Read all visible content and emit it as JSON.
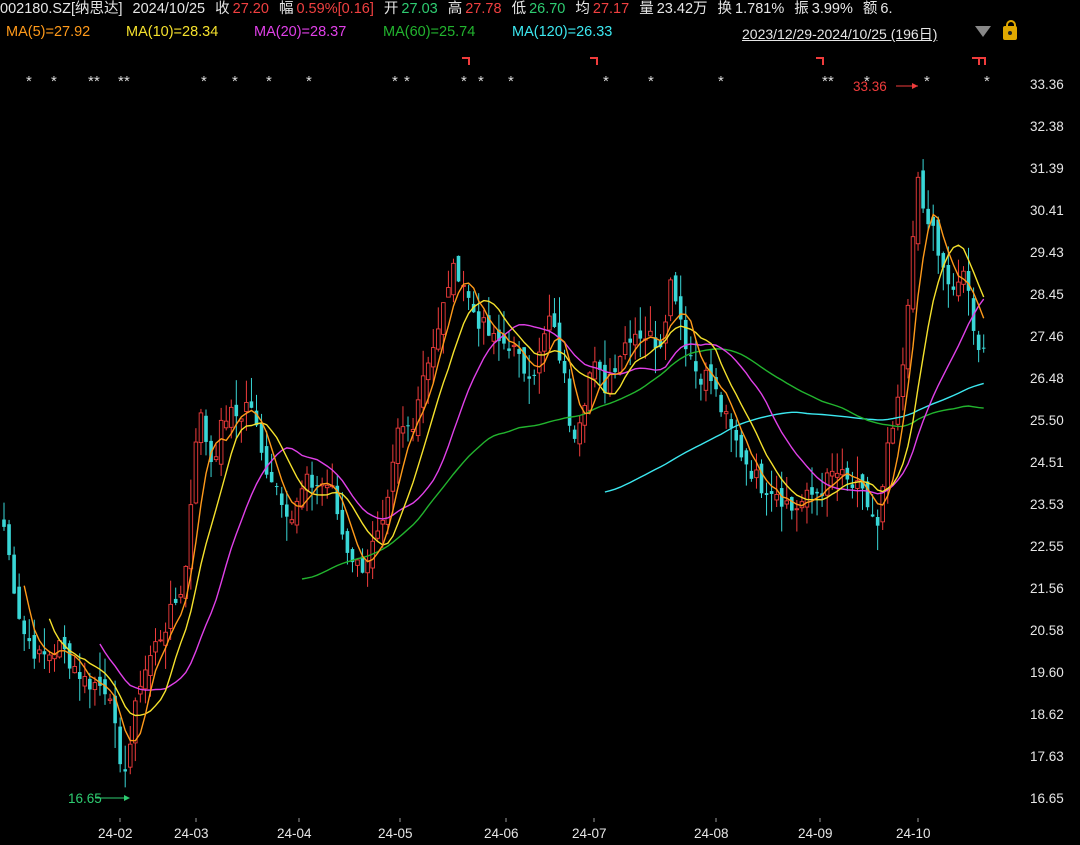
{
  "header": {
    "code": "002180.SZ[纳思达]",
    "date": "2024/10/25",
    "close_label": "收",
    "close": "27.20",
    "range_label": "幅",
    "range": "0.59%[0.16]",
    "open_label": "开",
    "open": "27.03",
    "high_label": "高",
    "high": "27.78",
    "low_label": "低",
    "low": "26.70",
    "avg_label": "均",
    "avg": "27.17",
    "vol_label": "量",
    "vol": "23.42万",
    "turn_label": "换",
    "turn": "1.781%",
    "amp_label": "振",
    "amp": "3.99%",
    "amt_label": "额",
    "amt": "6."
  },
  "ma_legend": {
    "ma5": "MA(5)=27.92",
    "ma10": "MA(10)=28.34",
    "ma20": "MA(20)=28.37",
    "ma60": "MA(60)=25.74",
    "ma120": "MA(120)=26.33"
  },
  "date_range": "2023/12/29-2024/10/25 (196日)",
  "colors": {
    "up": "#f03c3c",
    "down": "#39d6d6",
    "ma5": "#ff9a1a",
    "ma10": "#f5e12c",
    "ma20": "#e040e8",
    "ma60": "#22b42e",
    "ma120": "#3ce8f0"
  },
  "chart_data": {
    "type": "candlestick",
    "yticks": [
      "33.36",
      "32.38",
      "31.39",
      "30.41",
      "29.43",
      "28.45",
      "27.46",
      "26.48",
      "25.50",
      "24.51",
      "23.53",
      "22.55",
      "21.56",
      "20.58",
      "19.60",
      "18.62",
      "17.63",
      "16.65"
    ],
    "ylim": [
      16.65,
      33.36
    ],
    "xticks": [
      "24-02",
      "24-03",
      "24-04",
      "24-05",
      "24-06",
      "24-07",
      "24-08",
      "24-09",
      "24-10"
    ],
    "max_label": "33.36",
    "min_label": "16.65",
    "star_count": 23,
    "flag_count": 5
  }
}
